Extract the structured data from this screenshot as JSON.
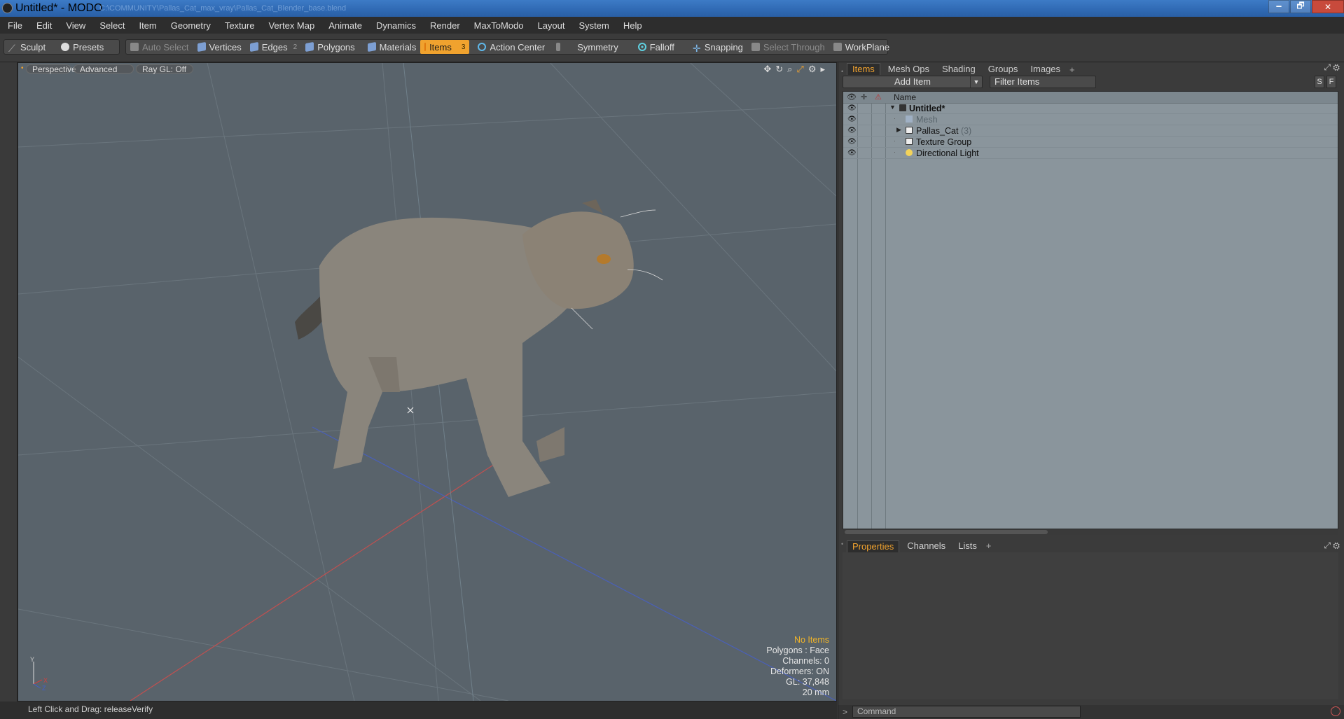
{
  "window": {
    "title": "Untitled* - MODO",
    "path": "C:\\COMMUNITY\\Pallas_Cat_max_vray\\Pallas_Cat_Blender_base.blend",
    "minimize": "🗕",
    "restore": "🗗",
    "close": "✕"
  },
  "menu": [
    "File",
    "Edit",
    "View",
    "Select",
    "Item",
    "Geometry",
    "Texture",
    "Vertex Map",
    "Animate",
    "Dynamics",
    "Render",
    "MaxToModo",
    "Layout",
    "System",
    "Help"
  ],
  "toolbar": {
    "sculpt": "Sculpt",
    "presets": "Presets",
    "auto_select": "Auto Select",
    "vertices": "Vertices",
    "edges": "Edges",
    "edges_count": "2",
    "polygons": "Polygons",
    "materials": "Materials",
    "items": "Items",
    "items_count": "3",
    "action_center": "Action Center",
    "symmetry": "Symmetry",
    "falloff": "Falloff",
    "snapping": "Snapping",
    "select_through": "Select Through",
    "workplane": "WorkPlane"
  },
  "viewport": {
    "view": "Perspective",
    "shading": "Advanced",
    "raygl": "Ray GL: Off",
    "stats": {
      "selection": "No Items",
      "polygons": "Polygons : Face",
      "channels": "Channels: 0",
      "deformers": "Deformers: ON",
      "gl": "GL: 37,848",
      "scale": "20 mm"
    },
    "axis": {
      "y": "Y",
      "x": "X",
      "z": "Z"
    }
  },
  "status": "Left Click and Drag:  releaseVerify",
  "items_panel": {
    "tabs": [
      "Items",
      "Mesh Ops",
      "Shading",
      "Groups",
      "Images"
    ],
    "plus": "+",
    "add_item": "Add Item",
    "filter": "Filter Items",
    "s_btn": "S",
    "f_btn": "F",
    "column_name": "Name",
    "rows": [
      {
        "label": "Untitled*"
      },
      {
        "label": "Mesh"
      },
      {
        "label": "Pallas_Cat",
        "count": "(3)"
      },
      {
        "label": "Texture Group"
      },
      {
        "label": "Directional Light"
      }
    ]
  },
  "props_panel": {
    "tabs": [
      "Properties",
      "Channels",
      "Lists"
    ],
    "plus": "+"
  },
  "command": {
    "prompt": ">",
    "placeholder": "Command"
  },
  "colors": {
    "accent": "#f0a22e",
    "viewport_bg": "#59636b",
    "tree_bg": "#8a959c"
  }
}
